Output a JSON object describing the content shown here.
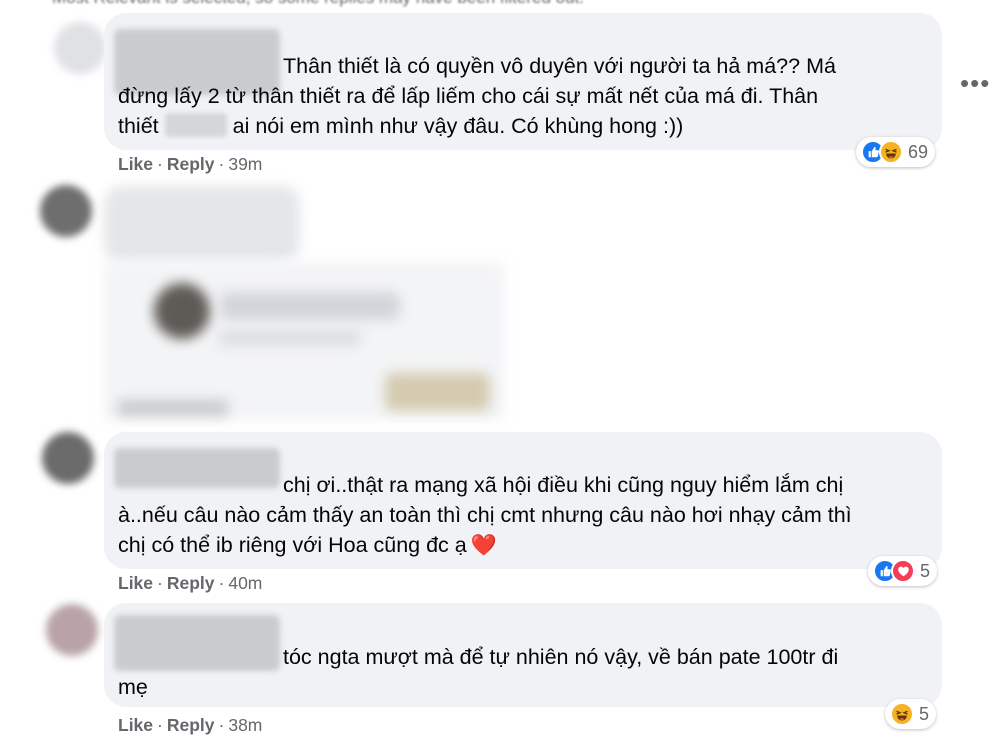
{
  "top_note": "Most Relevant is selected, so some replies may have been filtered out.",
  "more_options_label": "•••",
  "comments": [
    {
      "lines": [
        "Thân thiết là có quyền vô duyên với người ta hả má?? Má",
        "đừng lấy 2 từ thân thiết ra để lấp liếm cho cái sự mất nết của má đi. Thân"
      ],
      "line3_start": "thiết",
      "line3_end": "ai nói em mình như vậy đâu. Có khùng hong :))",
      "like_label": "Like",
      "reply_label": "Reply",
      "time": "39m",
      "reactions": [
        "like-icon",
        "haha-icon"
      ],
      "reaction_count": "69"
    },
    {
      "lines": [
        "chị ơi..thật ra mạng xã hội điều khi cũng nguy hiểm lắm chị",
        "à..nếu câu nào cảm thấy an toàn thì chị cmt nhưng câu nào hơi nhạy cảm thì",
        "chị có thể ib riêng với Hoa cũng đc ạ"
      ],
      "emoji": "❤️",
      "like_label": "Like",
      "reply_label": "Reply",
      "time": "40m",
      "reactions": [
        "like-icon",
        "love-icon"
      ],
      "reaction_count": "5"
    },
    {
      "lines": [
        "tóc ngta mượt mà để tự nhiên nó vậy, về bán pate 100tr đi",
        "mẹ"
      ],
      "like_label": "Like",
      "reply_label": "Reply",
      "time": "38m",
      "reactions": [
        "haha-icon"
      ],
      "reaction_count": "5"
    }
  ],
  "colors": {
    "bubble": "#f0f2f5",
    "meta_text": "#65676b",
    "like": "#1877f2",
    "haha": "#f7b125",
    "love": "#f33e58"
  }
}
